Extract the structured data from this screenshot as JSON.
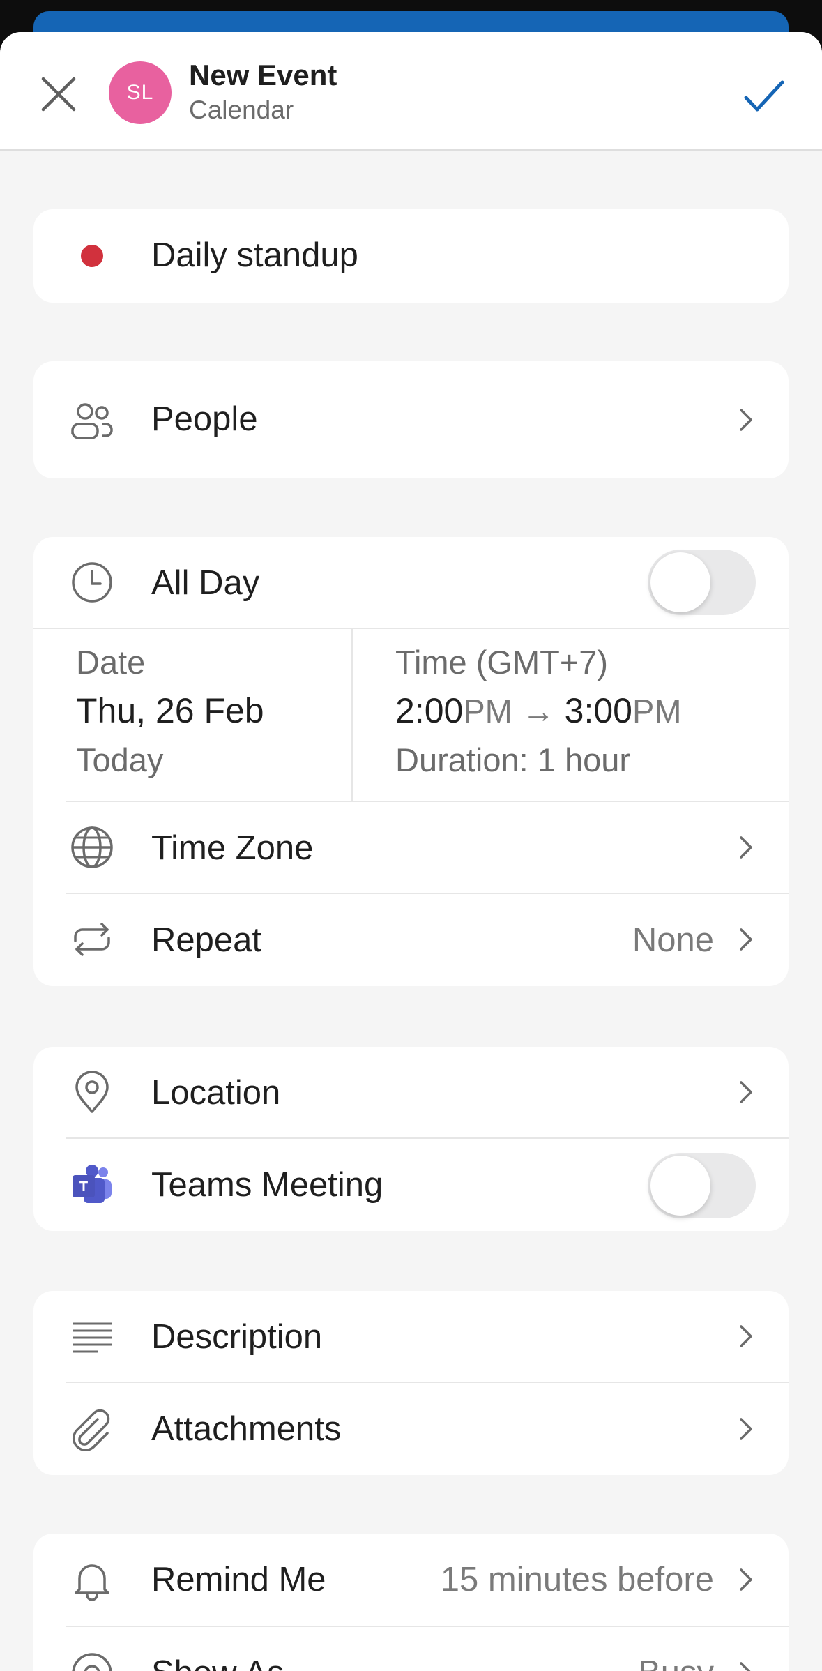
{
  "header": {
    "close_icon": "close-icon",
    "avatar_initials": "SL",
    "avatar_color": "#e8619f",
    "title": "New Event",
    "subtitle": "Calendar",
    "confirm_icon": "checkmark-icon",
    "accent_color": "#1565b5"
  },
  "event": {
    "title": "Daily standup",
    "color": "#d1313d"
  },
  "people": {
    "label": "People",
    "icon": "people-icon"
  },
  "schedule": {
    "all_day_label": "All Day",
    "all_day_on": false,
    "date_label": "Date",
    "date_value": "Thu, 26 Feb",
    "date_relative": "Today",
    "time_label": "Time (GMT+7)",
    "start_time": "2:00",
    "start_ampm": "PM",
    "arrow": "→",
    "end_time": "3:00",
    "end_ampm": "PM",
    "duration": "Duration: 1 hour",
    "time_zone_label": "Time Zone",
    "repeat_label": "Repeat",
    "repeat_value": "None"
  },
  "location": {
    "location_label": "Location",
    "teams_label": "Teams Meeting",
    "teams_on": false
  },
  "details": {
    "description_label": "Description",
    "attachments_label": "Attachments"
  },
  "alerts": {
    "remind_label": "Remind Me",
    "remind_value": "15 minutes before",
    "show_as_label": "Show As",
    "show_as_value": "Busy"
  }
}
